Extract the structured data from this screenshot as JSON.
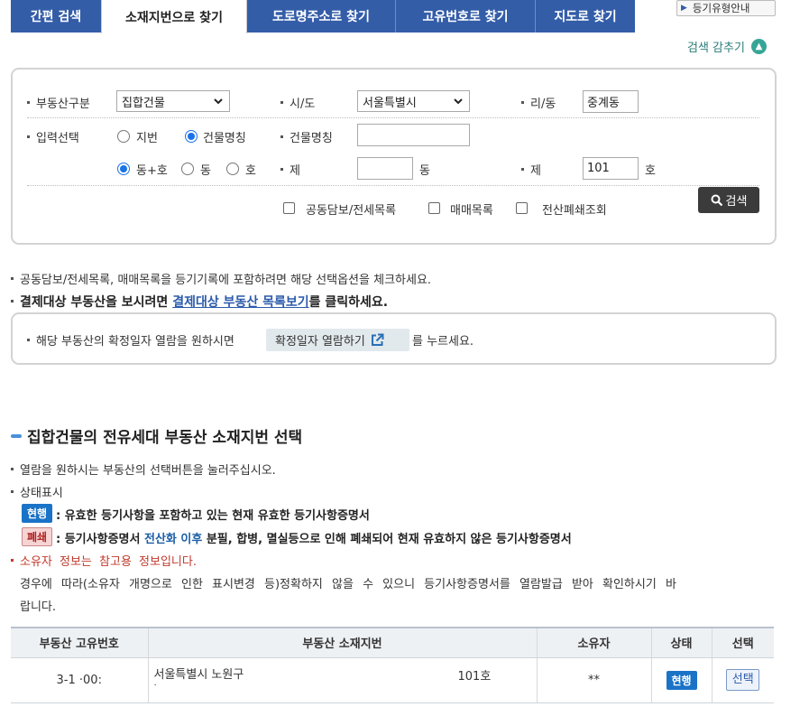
{
  "tabs": [
    {
      "label": "간편 검색"
    },
    {
      "label": "소재지번으로 찾기"
    },
    {
      "label": "도로명주소로 찾기"
    },
    {
      "label": "고유번호로 찾기"
    },
    {
      "label": "지도로 찾기"
    }
  ],
  "help_button": "등기유형안내",
  "hide_search": "검색 감추기",
  "form": {
    "property_type_label": "부동산구분",
    "property_type_value": "집합건물",
    "sido_label": "시/도",
    "sido_value": "서울특별시",
    "ri_dong_label": "리/동",
    "ri_dong_value": "중계동",
    "input_select_label": "입력선택",
    "radio_jibun": "지번",
    "radio_building_name": "건물명칭",
    "building_name_label": "건물명칭",
    "building_name_value": "",
    "radio_dong_ho": "동+호",
    "radio_dong": "동",
    "radio_ho": "호",
    "je_label_1": "제",
    "dong_value": "",
    "dong_suffix": "동",
    "je_label_2": "제",
    "ho_value": "101",
    "ho_suffix": "호",
    "chk_joint": "공동담보/전세목록",
    "chk_trade": "매매목록",
    "chk_closed": "전산폐쇄조회",
    "search_button": "검색"
  },
  "notes": {
    "note1": "공동담보/전세목록, 매매목록을 등기기록에 포함하려면 해당 선택옵션을 체크하세요.",
    "note2_prefix": "결제대상 부동산을 보시려면 ",
    "note2_link": "결제대상 부동산 목록보기",
    "note2_suffix": "를 클릭하세요."
  },
  "info": {
    "prefix": "해당 부동산의 확정일자 열람을 원하시면",
    "button": "확정일자 열람하기",
    "suffix": "를 누르세요."
  },
  "section": {
    "title": "집합건물의 전유세대 부동산 소재지번 선택",
    "line1": "열람을 원하시는 부동산의 선택버튼을 눌러주십시오.",
    "line2": "상태표시",
    "badge_current": "현행",
    "desc_current": ": 유효한 등기사항을 포함하고 있는 현재 유효한 등기사항증명서",
    "badge_closed": "폐쇄",
    "desc_closed_a": ": 등기사항증명서 ",
    "desc_closed_b": "전산화 이후",
    "desc_closed_c": " 분필, 합병, 멸실등으로 인해 폐쇄되어 현재 유효하지 않은 등기사항증명서",
    "owner_note": "소유자 정보는 참고용 정보입니다.",
    "owner_detail_1": "경우에 따라(소유자 개명으로 인한 표시변경 등)정확하지 않을 수 있으니 등기사항증명서를 열람발급 받아 확인하시기 바",
    "owner_detail_2": "랍니다."
  },
  "table": {
    "headers": [
      "부동산 고유번호",
      "부동산 소재지번",
      "소유자",
      "상태",
      "선택"
    ],
    "rows": [
      {
        "id": "3-1 ·00:",
        "address": "서울특별시 노원구",
        "address_line2": "·",
        "unit": "101호",
        "owner": "**",
        "status": "현행",
        "action": "선택"
      }
    ]
  }
}
